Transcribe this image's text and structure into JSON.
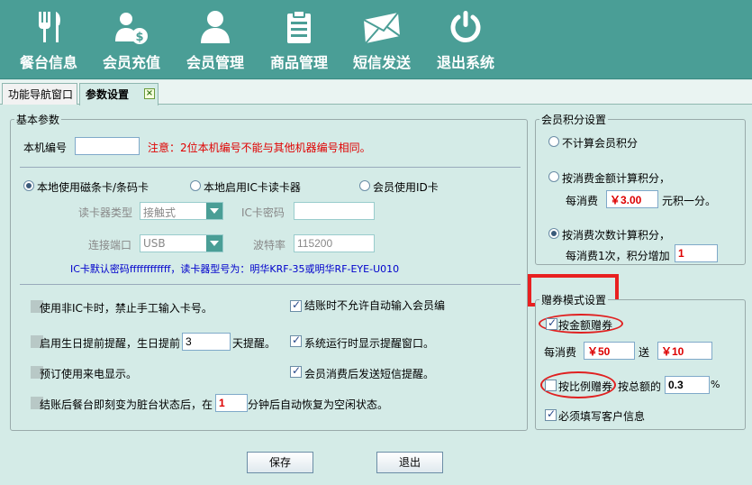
{
  "toolbar": {
    "items": [
      {
        "label": "餐台信息",
        "icon": "fork-knife-icon"
      },
      {
        "label": "会员充值",
        "icon": "member-money-icon"
      },
      {
        "label": "会员管理",
        "icon": "user-icon"
      },
      {
        "label": "商品管理",
        "icon": "clipboard-icon"
      },
      {
        "label": "短信发送",
        "icon": "envelope-icon"
      },
      {
        "label": "退出系统",
        "icon": "power-icon"
      }
    ]
  },
  "tabs": [
    {
      "label": "功能导航窗口"
    },
    {
      "label": "参数设置",
      "close": "×"
    }
  ],
  "basic": {
    "legend": "基本参数",
    "machine_label": "本机编号",
    "machine_value": "",
    "machine_note": "注意：2位本机编号不能与其他机器编号相同。",
    "card_options": [
      "本地使用磁条卡/条码卡",
      "本地启用IC卡读卡器",
      "会员使用ID卡"
    ],
    "reader_type_label": "读卡器类型",
    "reader_type_value": "接触式",
    "ic_password_label": "IC卡密码",
    "ic_password_value": "",
    "port_label": "连接端口",
    "port_value": "USB",
    "baud_label": "波特率",
    "baud_value": "115200",
    "ic_note": "IC卡默认密码ffffffffffff，读卡器型号为：明华KRF-35或明华RF-EYE-U010",
    "opt_no_manual": "使用非IC卡时，禁止手工输入卡号。",
    "opt_birthday_pre": "启用生日提前提醒，生日提前",
    "opt_birthday_days": "3",
    "opt_birthday_post": "天提醒。",
    "opt_caller": "预订使用来电显示。",
    "opt_dirty_pre": "结账后餐台即刻变为脏台状态后，在",
    "opt_dirty_minutes": "1",
    "opt_dirty_post": "分钟后自动恢复为空闲状态。",
    "opt_no_auto_member": "结账时不允许自动输入会员编",
    "opt_show_reminder": "系统运行时显示提醒窗口。",
    "opt_sms_after": "会员消费后发送短信提醒。"
  },
  "points": {
    "legend": "会员积分设置",
    "opt_none": "不计算会员积分",
    "opt_amount": "按消费金额计算积分，",
    "amount_pre": "每消费",
    "amount_value": "￥3.00",
    "amount_post": "元积一分。",
    "opt_count": "按消费次数计算积分，",
    "count_pre": "每消费1次，积分增加",
    "count_value": "1"
  },
  "coupon": {
    "legend": "赠券模式设置",
    "opt_amount": "按金额赠券",
    "spend_label": "每消费",
    "spend_value": "￥50",
    "give_label": "送",
    "give_value": "￥10",
    "opt_ratio": "按比例赠券",
    "ratio_label": "按总额的",
    "ratio_value": "0.3",
    "ratio_suffix": "%",
    "opt_customer": "必须填写客户信息"
  },
  "buttons": {
    "save": "保存",
    "exit": "退出"
  }
}
